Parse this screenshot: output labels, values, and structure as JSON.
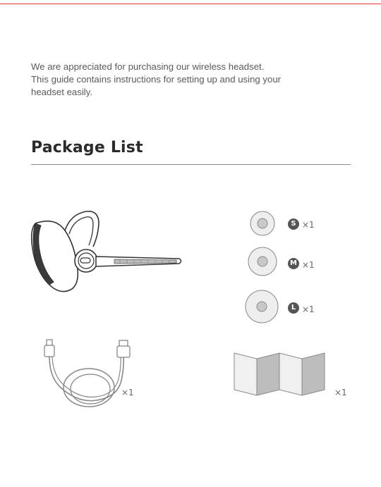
{
  "intro": {
    "line1": "We are appreciated for purchasing our wireless headset.",
    "line2": "This guide contains instructions for setting up and using your",
    "line3": "headset easily."
  },
  "section": {
    "title": "Package List"
  },
  "items": {
    "headset": {
      "icon": "bluetooth-headset-illustration"
    },
    "eartips": [
      {
        "size": "S",
        "qty": "×1"
      },
      {
        "size": "M",
        "qty": "×1"
      },
      {
        "size": "L",
        "qty": "×1"
      }
    ],
    "cable": {
      "icon": "usb-cable-illustration",
      "qty": "×1"
    },
    "manual": {
      "icon": "folded-manual-illustration",
      "qty": "×1"
    }
  },
  "colors": {
    "accent_rule": "#e5383b",
    "text": "#5a5a5a",
    "heading": "#2b2b2b"
  }
}
